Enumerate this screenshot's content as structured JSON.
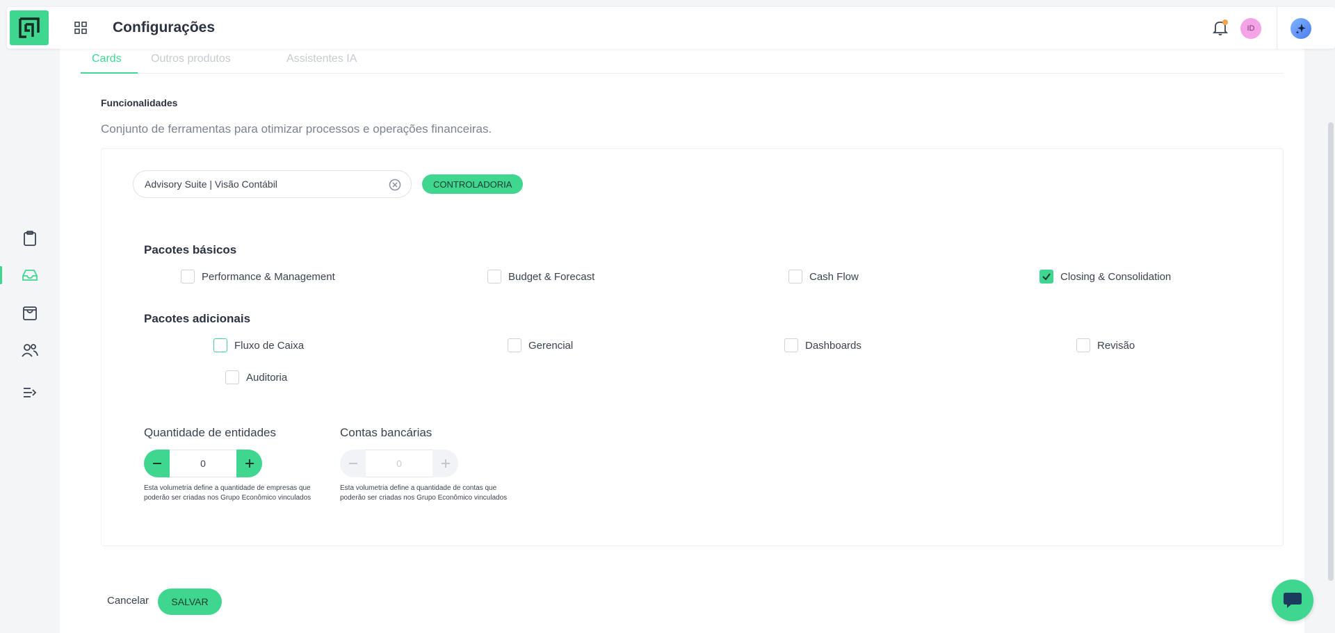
{
  "header": {
    "title": "Configurações",
    "avatar_initials": "ID"
  },
  "tabs": [
    {
      "label": "Cards",
      "active": true
    },
    {
      "label": "Outros produtos",
      "active": false
    },
    {
      "label": "Assistentes IA",
      "active": false
    }
  ],
  "section": {
    "title": "Funcionalidades",
    "description": "Conjunto de ferramentas para otimizar processos e operações financeiras."
  },
  "product": {
    "selected": "Advisory Suite | Visão Contábil",
    "tag": "CONTROLADORIA"
  },
  "basic_packages": {
    "title": "Pacotes básicos",
    "items": [
      {
        "label": "Performance & Management",
        "checked": false
      },
      {
        "label": "Budget & Forecast",
        "checked": false
      },
      {
        "label": "Cash Flow",
        "checked": false
      },
      {
        "label": "Closing & Consolidation",
        "checked": true
      }
    ]
  },
  "additional_packages": {
    "title": "Pacotes adicionais",
    "items": [
      {
        "label": "Fluxo de Caixa",
        "checked": false
      },
      {
        "label": "Gerencial",
        "checked": false
      },
      {
        "label": "Dashboards",
        "checked": false
      },
      {
        "label": "Revisão",
        "checked": false
      },
      {
        "label": "Auditoria",
        "checked": false
      }
    ]
  },
  "entities": {
    "label": "Quantidade de entidades",
    "value": "0",
    "help": "Esta volumetria define a quantidade de empresas que poderão ser criadas nos Grupo Econômico vinculados"
  },
  "bank_accounts": {
    "label": "Contas bancárias",
    "value": "0",
    "help": "Esta volumetria define a quantidade de contas que poderão ser criadas nos Grupo Econômico vinculados"
  },
  "actions": {
    "cancel": "Cancelar",
    "save": "SALVAR"
  },
  "colors": {
    "accent": "#3fd68f",
    "notification_dot": "#f0a44c",
    "avatar_bg": "#f3a3e6"
  },
  "icons": {
    "logo": "brand-logo-icon",
    "apps": "grid-apps-icon",
    "notifications": "bell-icon",
    "ai": "sparkle-ai-icon",
    "clear": "clear-circle-icon",
    "chat": "chat-bubble-icon",
    "sidebar": [
      "clipboard-icon",
      "inbox-icon",
      "shopping-bag-icon",
      "users-icon",
      "expand-menu-icon"
    ]
  }
}
